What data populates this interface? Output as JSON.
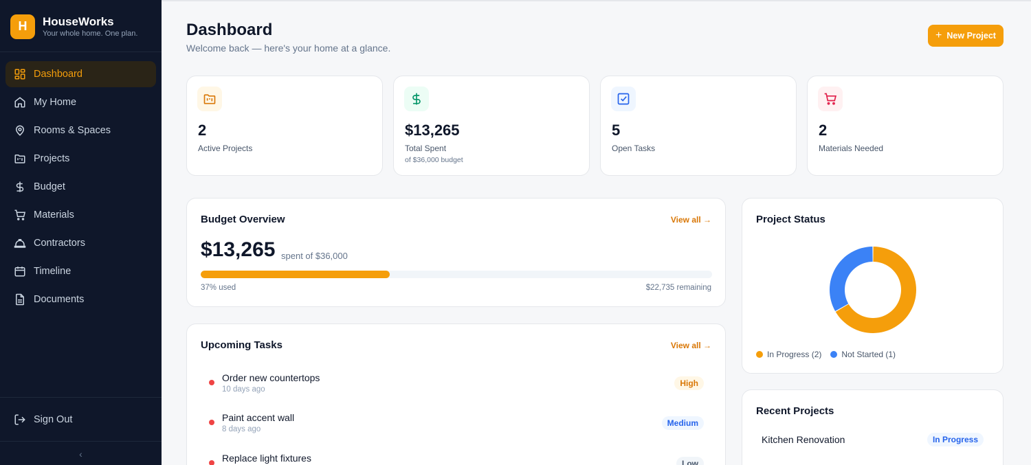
{
  "brand": {
    "initial": "H",
    "name": "HouseWorks",
    "tagline": "Your whole home. One plan."
  },
  "nav": {
    "items": [
      {
        "label": "Dashboard",
        "icon": "grid-icon",
        "active": true
      },
      {
        "label": "My Home",
        "icon": "home-icon"
      },
      {
        "label": "Rooms & Spaces",
        "icon": "map-pin-icon"
      },
      {
        "label": "Projects",
        "icon": "folder-kanban-icon"
      },
      {
        "label": "Budget",
        "icon": "dollar-icon"
      },
      {
        "label": "Materials",
        "icon": "cart-icon"
      },
      {
        "label": "Contractors",
        "icon": "hard-hat-icon"
      },
      {
        "label": "Timeline",
        "icon": "calendar-icon"
      },
      {
        "label": "Documents",
        "icon": "file-icon"
      }
    ],
    "sign_out": "Sign Out",
    "collapse_glyph": "‹"
  },
  "header": {
    "title": "Dashboard",
    "subtitle": "Welcome back — here's your home at a glance.",
    "new_project": "New Project",
    "plus": "+"
  },
  "stats": [
    {
      "value": "2",
      "label": "Active Projects",
      "icon": "folder-kanban-icon",
      "color": "#d97706",
      "bg": "#fff7e6"
    },
    {
      "value": "$13,265",
      "label": "Total Spent",
      "note": "of $36,000 budget",
      "icon": "dollar-icon",
      "color": "#059669",
      "bg": "#ecfdf5"
    },
    {
      "value": "5",
      "label": "Open Tasks",
      "icon": "check-square-icon",
      "color": "#2563eb",
      "bg": "#eff6ff"
    },
    {
      "value": "2",
      "label": "Materials Needed",
      "icon": "cart-icon",
      "color": "#e11d48",
      "bg": "#fff1f2"
    }
  ],
  "budget": {
    "title": "Budget Overview",
    "view_all": "View all →",
    "amount": "$13,265",
    "sub": "spent of $36,000",
    "used_fraction": 0.37,
    "used_label": "37% used",
    "remaining_label": "$22,735 remaining"
  },
  "tasks": {
    "title": "Upcoming Tasks",
    "view_all": "View all →",
    "items": [
      {
        "name": "Order new countertops",
        "when": "10 days ago",
        "priority": "High",
        "pcolor": "#d97706",
        "pbg": "#fff7e6"
      },
      {
        "name": "Paint accent wall",
        "when": "8 days ago",
        "priority": "Medium",
        "pcolor": "#2563eb",
        "pbg": "#eff6ff"
      },
      {
        "name": "Replace light fixtures",
        "when": "",
        "priority": "Low",
        "pcolor": "#475569",
        "pbg": "#f1f5f9"
      }
    ]
  },
  "project_status": {
    "title": "Project Status",
    "segments": [
      {
        "label": "In Progress (2)",
        "value": 2,
        "color": "#f59e0b"
      },
      {
        "label": "Not Started (1)",
        "value": 1,
        "color": "#3b82f6"
      }
    ]
  },
  "recent_projects": {
    "title": "Recent Projects",
    "items": [
      {
        "name": "Kitchen Renovation",
        "status": "In Progress"
      }
    ]
  }
}
